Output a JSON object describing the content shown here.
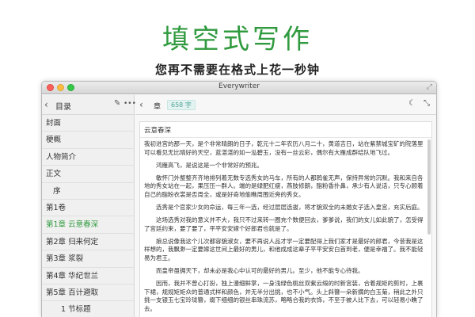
{
  "hero": {
    "title": "填空式写作",
    "subtitle": "您再不需要在格式上花一秒钟"
  },
  "window": {
    "title": "Everywriter"
  },
  "sidebar": {
    "title": "目录",
    "items": [
      {
        "label": "封面",
        "level": 0,
        "active": false
      },
      {
        "label": "梗概",
        "level": 0,
        "active": false
      },
      {
        "label": "人物简介",
        "level": 0,
        "active": false
      },
      {
        "label": "正文",
        "level": 0,
        "active": false
      },
      {
        "label": "序",
        "level": 1,
        "active": false
      },
      {
        "label": "第1卷",
        "level": 0,
        "active": false
      },
      {
        "label": "第1章 云意春深",
        "level": 0,
        "active": true
      },
      {
        "label": "第2章 归来何定",
        "level": 0,
        "active": false
      },
      {
        "label": "第3章 浆裂",
        "level": 0,
        "active": false
      },
      {
        "label": "第4章 华纪世兰",
        "level": 0,
        "active": false
      },
      {
        "label": "第5章 百计避取",
        "level": 0,
        "active": false
      },
      {
        "label": "1 节标题",
        "level": 2,
        "active": false
      }
    ]
  },
  "editor": {
    "chapter_label": "章",
    "word_count": "658 字",
    "doc_title": "云意春深",
    "paragraphs": [
      {
        "text": "我初进宫的那一天，是个非常晴朗的日子，乾元十二年农历八月二十，黄道吉日，站在紫禁城宝矿的院落里可以看见无比晴好的天空，蓝湛湛的如一泓碧玉，没有一丝云彩，偶尔有大雁成群结队地飞过。",
        "indent": false
      },
      {
        "text": "鸿雁高飞，是说这是一个非常好的预兆。",
        "indent": true
      },
      {
        "text": "敏怀门外整整齐齐地排列着无数专选秀女的马车，所有的人都鸦雀无声，保持异常的沉默。我和来自各地的秀女站在一起，果压压一群人。端的是绿肥红瘦，燕肢修朗，脂粉香扑鼻，承少有人说话，只专心顾着自己的脂粉衣裳是否周全，或是好奇地偷瞧周围近旁的秀女。",
        "indent": true
      },
      {
        "text": "选秀是个官家少女的命运，每三年一选，经过层层选拔，将才貌双全的未婚女子选入皇宫，充实后庭。",
        "indent": true
      },
      {
        "text": "这场选秀对我的意义并不大，我只不过来转一圈充个数便回去，爹爹说，我们的女儿如此貌了，怎受得了宫廷约束，要了要了，平平安安嫁个好郎君也就是了。",
        "indent": true
      },
      {
        "text": "娘总说像我这个儿次都容貌淑女，要不再说人品才学一定要配得上我们家才是最好的郎君，今昔我是这样想的，我飘渺一定要嫁这世间上最好的男儿，和他成成这辈子平平安安白首到老，便是幸福了。我不能轻易为君王。",
        "indent": true
      },
      {
        "text": "而皇帝虽拥天下，却未必是我心中认可的最好的男儿。至少，他不能专心待我。",
        "indent": true
      },
      {
        "text": "因而，我并不曾心打扮，独上漫细鲜掌，一身浅绿色桃丝双紫云缎的时新宫装，合着规矩的剪时，上裹下裙，规规矩矩众的普通式样和颜色，并无半分出挑，也不小气。头上斜簪一朵新摘的白玉菊，稍此之外只挑一支银玉七宝玲珑簪，缀下细细的银丝串珠流苏，略略合我的衣饰，不至于被人比下去，可以轻易小瞧了去。",
        "indent": true
      }
    ]
  },
  "icons": {
    "back": "chevron-left-icon",
    "edit": "edit-icon",
    "more": "more-icon",
    "moon": "moon-icon",
    "shrink": "shrink-icon",
    "fullscreen": "fullscreen-icon"
  },
  "colors": {
    "accent": "#2f9a3e",
    "count_badge": "#e2f3f1"
  }
}
